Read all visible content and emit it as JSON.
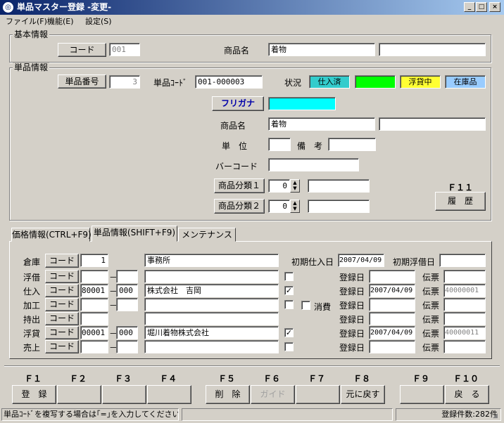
{
  "window": {
    "title": "単品マスター登録 -変更-",
    "app_icon": "app-icon",
    "minimize": "_",
    "maximize": "□",
    "close": "×"
  },
  "menu": [
    "ファイル(F)",
    "機能(E)",
    "設定(S)"
  ],
  "basic": {
    "legend": "基本情報",
    "code_label": "コード",
    "code_value": "001",
    "product_label": "商品名",
    "product_value": "着物",
    "product_value2": ""
  },
  "item": {
    "legend": "単品情報",
    "number_label": "単品番号",
    "number_value": "3",
    "code_label": "単品ｺｰﾄﾞ",
    "code_value": "001-000003",
    "status_label": "状況",
    "status_badges": [
      {
        "label": "仕入済",
        "color": "#33cccc"
      },
      {
        "label": "",
        "color": "#00ff00"
      },
      {
        "label": "浮貸中",
        "color": "#ffff33"
      },
      {
        "label": "在庫品",
        "color": "#99ccff"
      }
    ],
    "furigana_label": "フリガナ",
    "furigana_value": "",
    "furigana_color": "#00ffff",
    "product_label": "商品名",
    "product_value": "着物",
    "product_value2": "",
    "unit_label": "単　位",
    "unit_value": "",
    "remarks_label": "備　考",
    "remarks_value": "",
    "barcode_label": "バーコード",
    "barcode_value": "",
    "cat1_label": "商品分類１",
    "cat1_value": "0",
    "cat1_name": "",
    "cat2_label": "商品分類２",
    "cat2_value": "0",
    "cat2_name": "",
    "f11_label": "Ｆ１１",
    "history_label": "履　歴"
  },
  "tabs": [
    "価格情報(CTRL+F9)",
    "単品情報(SHIFT+F9)",
    "メンテナンス"
  ],
  "detail": {
    "warehouse_label": "倉庫",
    "code_btn": "コード",
    "warehouse_code": "1",
    "warehouse_name": "事務所",
    "first_purchase_label": "初期仕入日",
    "first_purchase_value": "2007/04/09",
    "first_float_label": "初期浮借日",
    "first_float_value": "",
    "reg_label": "登録日",
    "slip_label": "伝票",
    "consume_label": "消費",
    "rows": [
      {
        "label": "浮借",
        "code": "",
        "sub": "",
        "name": "",
        "checked": false,
        "reg": "",
        "slip": ""
      },
      {
        "label": "仕入",
        "code": "80001",
        "sub": "000",
        "name": "株式会社　吉岡",
        "checked": true,
        "reg": "2007/04/09",
        "slip": "40000001"
      },
      {
        "label": "加工",
        "code": "",
        "sub": "",
        "name": "",
        "checked": false,
        "reg": "",
        "slip": ""
      },
      {
        "label": "持出",
        "code": "",
        "sub": "",
        "name": "",
        "checked": false,
        "reg": "",
        "slip": ""
      },
      {
        "label": "浮貸",
        "code": "00001",
        "sub": "000",
        "name": "堀川着物株式会社",
        "checked": true,
        "reg": "2007/04/09",
        "slip": "40000011"
      },
      {
        "label": "売上",
        "code": "",
        "sub": "",
        "name": "",
        "checked": false,
        "reg": "",
        "slip": ""
      }
    ]
  },
  "fkeys": [
    {
      "key": "Ｆ１",
      "label": "登　録"
    },
    {
      "key": "Ｆ２",
      "label": ""
    },
    {
      "key": "Ｆ３",
      "label": ""
    },
    {
      "key": "Ｆ４",
      "label": ""
    },
    {
      "key": "Ｆ５",
      "label": "削　除"
    },
    {
      "key": "Ｆ６",
      "label": "ガイド"
    },
    {
      "key": "Ｆ７",
      "label": ""
    },
    {
      "key": "Ｆ８",
      "label": "元に戻す"
    },
    {
      "key": "Ｆ９",
      "label": ""
    },
    {
      "key": "Ｆ１０",
      "label": "戻　る"
    }
  ],
  "statusbar": {
    "message": "単品ｺｰﾄﾞを複写する場合は｢=｣を入力してください",
    "middle": "",
    "count": "登録件数:282件"
  }
}
